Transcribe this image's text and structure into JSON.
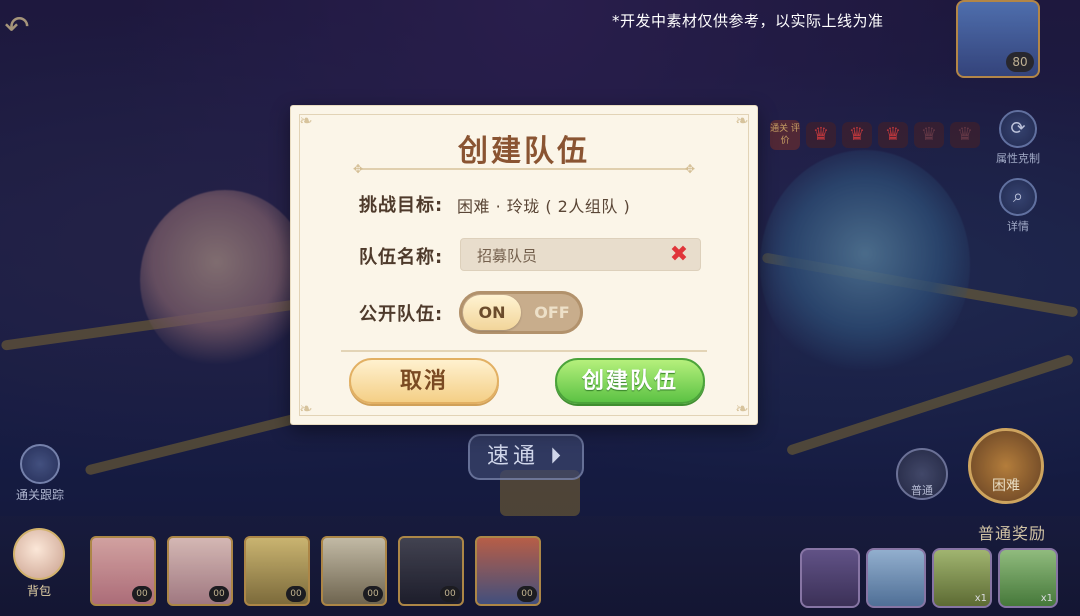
{
  "top_hint": "*开发中素材仅供参考，以实际上线为准",
  "modal": {
    "title": "创建队伍",
    "challenge_label": "挑战目标:",
    "challenge_value": "困难 · 玲珑 ( 2人组队 )",
    "team_name_label": "队伍名称:",
    "team_name_value": "招募队员",
    "public_label": "公开队伍:",
    "toggle_on": "ON",
    "toggle_off": "OFF",
    "toggle_state": "on",
    "cancel_button": "取消",
    "create_button": "创建队伍"
  },
  "background": {
    "top_card_level": "80",
    "crown_tag": "通关 评价",
    "attribute_button": "属性克制",
    "detail_button": "详情",
    "track_button": "通关跟踪",
    "pass_button": "速通",
    "boss_left_label": "困难",
    "boss_mid_label": "普通",
    "avatar_label": "背包",
    "reward_title": "普通奖励",
    "team_levels": [
      "00",
      "00",
      "00",
      "00",
      "00",
      "00"
    ],
    "reward_counts": [
      "",
      "",
      "x1",
      "x1"
    ]
  },
  "colors": {
    "modal_bg": "#fbf5e8",
    "title": "#8a5432",
    "create_green": "#5cc244",
    "cancel_gold": "#f4cf86",
    "clear_red": "#e0353a"
  }
}
